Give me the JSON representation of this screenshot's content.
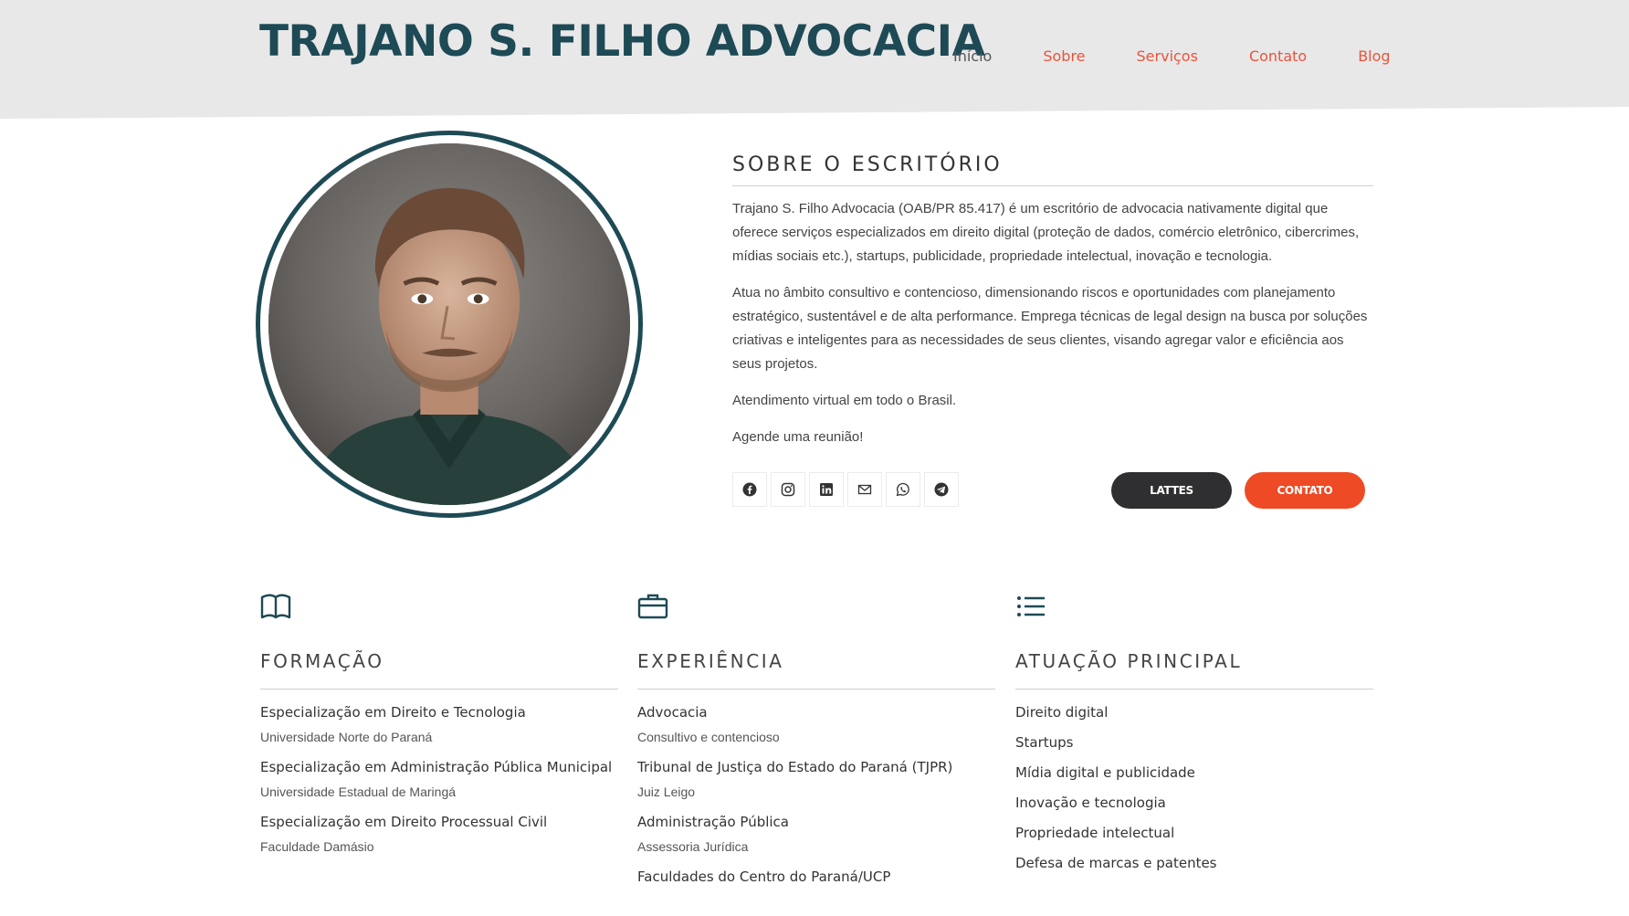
{
  "header": {
    "brand": "TRAJANO S. FILHO ADVOCACIA",
    "nav": [
      "Início",
      "Sobre",
      "Serviços",
      "Contato",
      "Blog"
    ],
    "active_nav": "Início"
  },
  "profile": {
    "photo_alt": "portrait-photo"
  },
  "about": {
    "title": "SOBRE O ESCRITÓRIO",
    "p1": "Trajano S. Filho Advocacia (OAB/PR 85.417) é um escritório de advocacia nativamente digital que oferece serviços especializados em direito digital (proteção de dados, comércio eletrônico, cibercrimes, mídias sociais etc.), startups, publicidade, propriedade intelectual, inovação e tecnologia.",
    "p2": "Atua no âmbito consultivo e contencioso, dimensionando riscos e oportunidades com planejamento estratégico, sustentável e de alta performance. Emprega técnicas de legal design na busca por soluções criativas e inteligentes para as necessidades de seus clientes, visando agregar valor e eficiência aos seus projetos.",
    "p3": "Atendimento virtual em todo o Brasil.",
    "p4": "Agende uma reunião!",
    "socials": [
      "facebook-icon",
      "instagram-icon",
      "linkedin-icon",
      "email-icon",
      "whatsapp-icon",
      "telegram-icon"
    ],
    "btn_lattes": "LATTES",
    "btn_contato": "CONTATO"
  },
  "colors": {
    "brand": "#1d4a55",
    "accent": "#ee4a25",
    "dark_button": "#2f2f31"
  },
  "formacao": {
    "title": "FORMAÇÃO",
    "icon": "book-icon",
    "items": [
      {
        "t": "Especialização em Direito e Tecnologia",
        "s": "Universidade Norte do Paraná"
      },
      {
        "t": "Especialização em Administração Pública Municipal",
        "s": "Universidade Estadual de Maringá"
      },
      {
        "t": "Especialização em Direito Processual Civil",
        "s": "Faculdade Damásio"
      }
    ]
  },
  "experiencia": {
    "title": "EXPERIÊNCIA",
    "icon": "briefcase-icon",
    "items": [
      {
        "t": "Advocacia",
        "s": "Consultivo e contencioso"
      },
      {
        "t": "Tribunal de Justiça do Estado do Paraná (TJPR)",
        "s": "Juiz Leigo"
      },
      {
        "t": "Administração Pública",
        "s": "Assessoria Jurídica"
      },
      {
        "t": "Faculdades do Centro do Paraná/UCP",
        "s": ""
      }
    ]
  },
  "atuacao": {
    "title": "ATUAÇÃO PRINCIPAL",
    "icon": "list-icon",
    "items": [
      "Direito digital",
      "Startups",
      "Mídia digital e publicidade",
      "Inovação e tecnologia",
      "Propriedade intelectual",
      "Defesa de marcas e patentes"
    ]
  }
}
